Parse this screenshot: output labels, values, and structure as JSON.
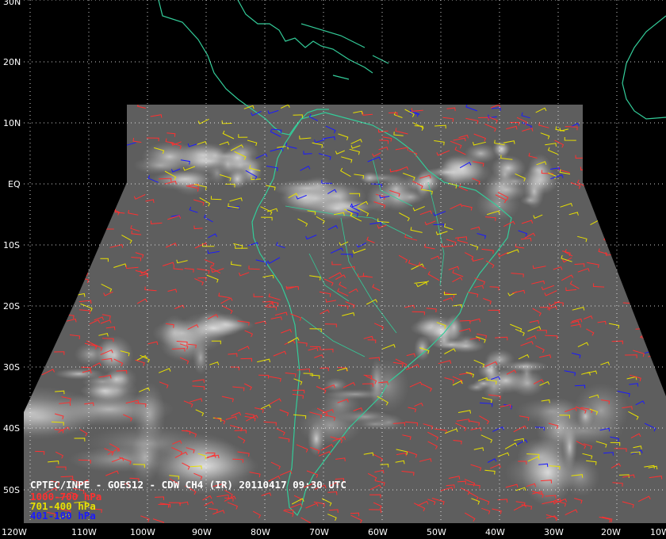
{
  "image": {
    "source_line": "CPTEC/INPE - GOES12 - CDW CH4 (IR) 20110417 09:30 UTC",
    "legend": [
      {
        "label": "1000-700 hPa",
        "color": "#ff3030"
      },
      {
        "label": "701-400 hPa",
        "color": "#e8e000"
      },
      {
        "label": "401-100 hPa",
        "color": "#1a1aff"
      }
    ]
  },
  "grid": {
    "lat_labels": [
      "30N",
      "20N",
      "10N",
      "EQ",
      "10S",
      "20S",
      "30S",
      "40S",
      "50S"
    ],
    "lon_labels": [
      "120W",
      "110W",
      "100W",
      "90W",
      "80W",
      "70W",
      "60W",
      "50W",
      "40W",
      "30W",
      "20W",
      "10W"
    ],
    "line_style": "dotted white"
  },
  "colors": {
    "background": "#000000",
    "coastline": "#33cc99",
    "satellite_gray": "#6a6a6a",
    "grid": "#ffffff"
  }
}
